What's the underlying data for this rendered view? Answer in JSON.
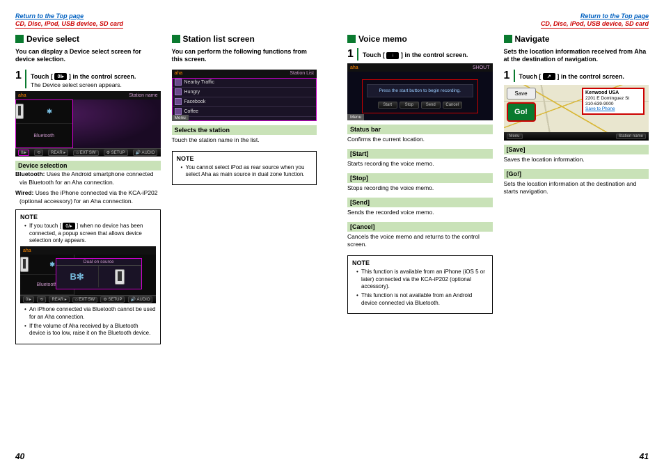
{
  "header": {
    "return_link": "Return to the Top page",
    "breadcrumb": "CD, Disc, iPod, USB device, SD card"
  },
  "page_numbers": {
    "left": "40",
    "right": "41"
  },
  "device_select": {
    "heading": "Device select",
    "intro": "You can display a Device select screen for device selection.",
    "step_num": "1",
    "step_pre": "Touch [",
    "step_icon": "0/▸",
    "step_post": "] in the control screen.",
    "step_sub": "The Device select screen appears.",
    "shot": {
      "brand": "aha",
      "title_right": "Station name",
      "left_label_bt": "Bluetooth",
      "toolbar": [
        "0/▸",
        "⟲",
        "REAR ▸",
        "⌂ EXT SW",
        "⚙ SETUP",
        "🔊 AUDIO"
      ]
    },
    "band1": "Device selection",
    "dl": [
      {
        "term": "Bluetooth:",
        "def": " Uses the Android smartphone connected via Bluetooth for an Aha connection."
      },
      {
        "term": "Wired:",
        "def": " Uses the iPhone connected via the KCA-iP202 (optional accessory) for an Aha connection."
      }
    ],
    "note_title": "NOTE",
    "note1_pre": "If you touch [",
    "note1_icon": "0/▸",
    "note1_post": "] when no device has been connected, a popup screen that allows device selection only appears.",
    "shot2": {
      "popup_title": "Dual on source",
      "bt_big": "B✻"
    },
    "note2": "An iPhone connected via Bluetooth cannot be used for an Aha connection.",
    "note3": "If the volume of Aha received by a Bluetooth device is too low, raise it on the Bluetooth device."
  },
  "station_list": {
    "heading": "Station list screen",
    "intro": "You can perform the following functions from this screen.",
    "shot": {
      "brand": "aha",
      "title_right": "Station List",
      "rows": [
        "Nearby Traffic",
        "Hungry",
        "Facebook",
        "Coffee"
      ],
      "menu": "Menu"
    },
    "band": "Selects the station",
    "desc": "Touch the station name in the list.",
    "note_title": "NOTE",
    "note1": "You cannot select iPod as rear source when you select Aha as main source in dual zone function."
  },
  "voice_memo": {
    "heading": "Voice memo",
    "step_num": "1",
    "step_pre": "Touch [",
    "step_icon": "↓",
    "step_post": "] in the control screen.",
    "shot": {
      "brand": "aha",
      "title_right": "SHOUT",
      "msg": "Press the start button to begin recording.",
      "btns": [
        "Start",
        "Stop",
        "Send",
        "Cancel"
      ],
      "menu": "Menu"
    },
    "items": [
      {
        "band": "Status bar",
        "desc": "Confirms the current location."
      },
      {
        "band": "[Start]",
        "desc": "Starts recording the voice memo."
      },
      {
        "band": "[Stop]",
        "desc": "Stops recording the voice memo."
      },
      {
        "band": "[Send]",
        "desc": "Sends the recorded voice memo."
      },
      {
        "band": "[Cancel]",
        "desc": "Cancels the voice memo and returns to the control screen."
      }
    ],
    "note_title": "NOTE",
    "note1": "This function is available from an iPhone (iOS 5 or later) connected via the KCA-iP202 (optional accessory).",
    "note2": "This function is not available from an Android device connected via Bluetooth."
  },
  "navigate": {
    "heading": "Navigate",
    "intro": "Sets the location information received from Aha at the destination of navigation.",
    "step_num": "1",
    "step_pre": "Touch [",
    "step_icon": "↗",
    "step_post": "] in the control screen.",
    "shot": {
      "save": "Save",
      "go": "Go!",
      "dest_name": "Kenwood USA",
      "dest_addr": "2201 E Dominguez St",
      "dest_phone": "310-639-9000",
      "dest_link": "Save to Phone",
      "menu": "Menu",
      "bottom_right": "Station name"
    },
    "items": [
      {
        "band": "[Save]",
        "desc": "Saves the location information."
      },
      {
        "band": "[Go!]",
        "desc": "Sets the location information at the destination and starts navigation."
      }
    ]
  }
}
